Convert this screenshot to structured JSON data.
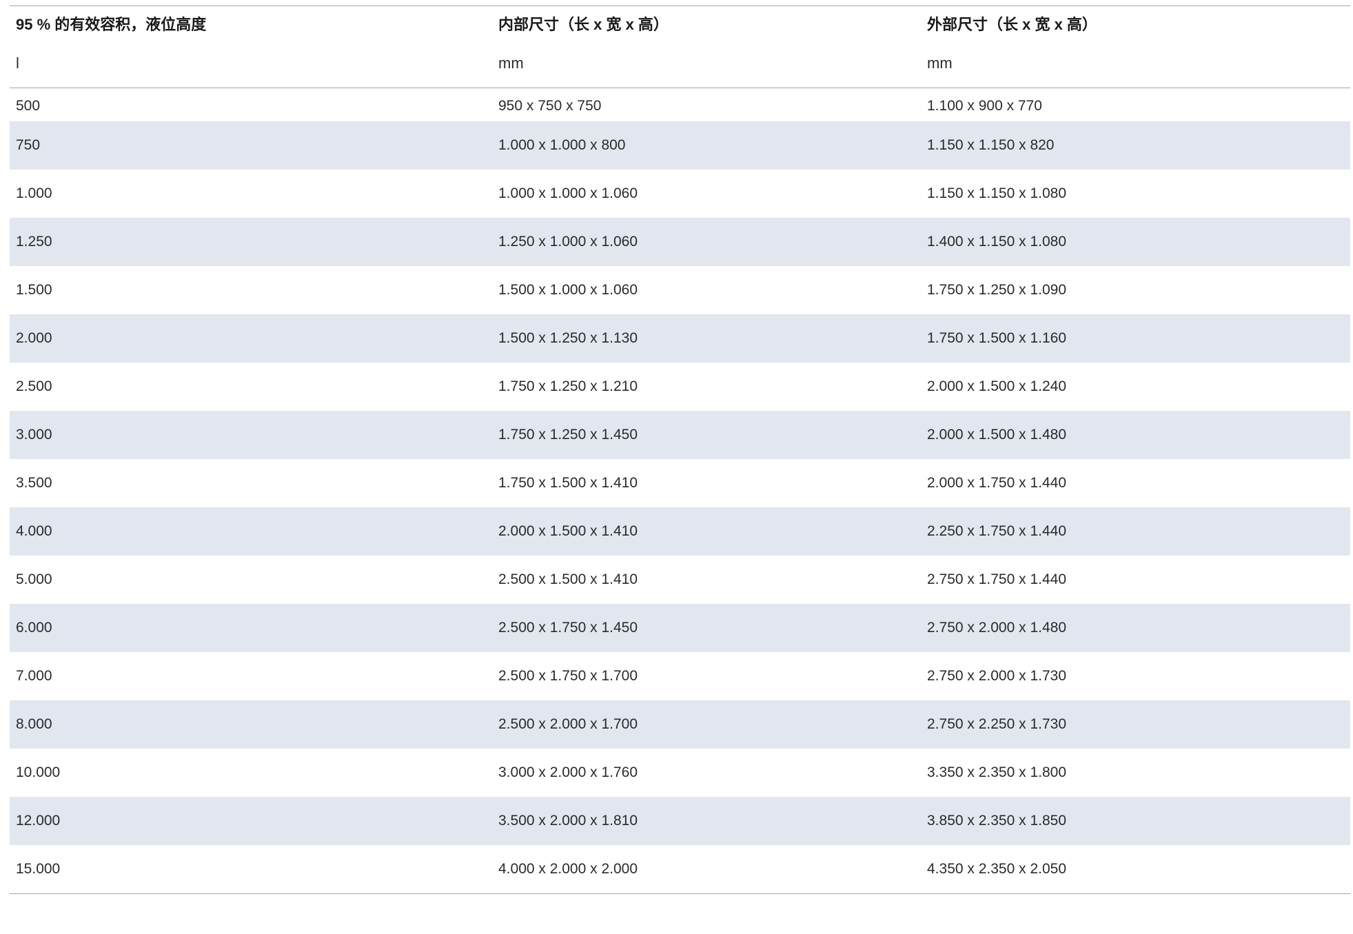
{
  "table": {
    "headers": [
      "95 % 的有效容积，液位高度",
      "内部尺寸（长 x 宽 x 高）",
      "外部尺寸（长 x 宽 x 高）"
    ],
    "units": [
      "l",
      "mm",
      "mm"
    ],
    "rows": [
      [
        "500",
        "950 x 750 x 750",
        "1.100 x 900 x 770"
      ],
      [
        "750",
        "1.000 x 1.000 x 800",
        "1.150 x 1.150 x 820"
      ],
      [
        "1.000",
        "1.000 x 1.000 x 1.060",
        "1.150 x 1.150 x 1.080"
      ],
      [
        "1.250",
        "1.250 x 1.000 x 1.060",
        "1.400 x 1.150 x 1.080"
      ],
      [
        "1.500",
        "1.500 x 1.000 x 1.060",
        "1.750 x 1.250 x 1.090"
      ],
      [
        "2.000",
        "1.500 x 1.250 x 1.130",
        "1.750 x 1.500 x 1.160"
      ],
      [
        "2.500",
        "1.750 x 1.250 x 1.210",
        "2.000 x 1.500 x 1.240"
      ],
      [
        "3.000",
        "1.750 x 1.250 x 1.450",
        "2.000 x 1.500 x 1.480"
      ],
      [
        "3.500",
        "1.750 x 1.500 x 1.410",
        "2.000 x 1.750 x 1.440"
      ],
      [
        "4.000",
        "2.000 x 1.500 x 1.410",
        "2.250 x 1.750 x 1.440"
      ],
      [
        "5.000",
        "2.500 x 1.500 x 1.410",
        "2.750 x 1.750 x 1.440"
      ],
      [
        "6.000",
        "2.500 x 1.750 x 1.450",
        "2.750 x 2.000 x 1.480"
      ],
      [
        "7.000",
        "2.500 x 1.750 x 1.700",
        "2.750 x 2.000 x 1.730"
      ],
      [
        "8.000",
        "2.500 x 2.000 x 1.700",
        "2.750 x 2.250 x 1.730"
      ],
      [
        "10.000",
        "3.000 x 2.000 x 1.760",
        "3.350 x 2.350 x 1.800"
      ],
      [
        "12.000",
        "3.500 x 2.000 x 1.810",
        "3.850 x 2.350 x 1.850"
      ],
      [
        "15.000",
        "4.000 x 2.000 x 2.000",
        "4.350 x 2.350 x 2.050"
      ]
    ]
  }
}
